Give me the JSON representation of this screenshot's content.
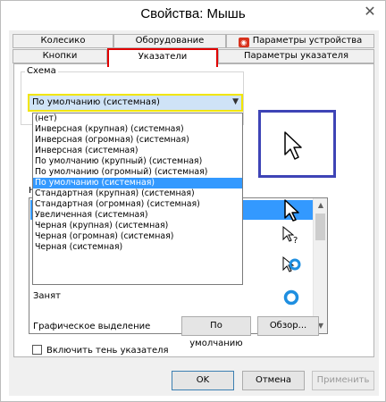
{
  "window": {
    "title": "Свойства: Мышь",
    "close_glyph": "✕"
  },
  "tabs_row1": [
    {
      "label": "Колесико"
    },
    {
      "label": "Оборудование"
    },
    {
      "label": "Параметры устройства",
      "icon": "device-settings-icon"
    }
  ],
  "tabs_row2": [
    {
      "label": "Кнопки"
    },
    {
      "label": "Указатели",
      "active": true
    },
    {
      "label": "Параметры указателя"
    }
  ],
  "scheme": {
    "legend": "Схема",
    "selected": "По умолчанию (системная)",
    "options": [
      "(нет)",
      "Инверсная (крупная) (системная)",
      "Инверсная (огромная) (системная)",
      "Инверсная (системная)",
      "По умолчанию (крупный) (системная)",
      "По умолчанию (огромный) (системная)",
      "По умолчанию (системная)",
      "Стандартная (крупная) (системная)",
      "Стандартная (огромная) (системная)",
      "Увеличенная (системная)",
      "Черная (крупная) (системная)",
      "Черная (огромная) (системная)",
      "Черная (системная)"
    ],
    "selected_index": 6
  },
  "settings_label_prefix": "Н",
  "cursor_list": {
    "rows": [
      {
        "label": "",
        "icon": "arrow-cursor-icon"
      },
      {
        "label": "",
        "icon": "help-cursor-icon"
      },
      {
        "label": "",
        "icon": "working-in-background-icon"
      },
      {
        "label": "Занят",
        "icon": "busy-ring-icon"
      },
      {
        "label": "Графическое выделение",
        "icon": "crosshair-icon"
      }
    ],
    "selected_index": 0
  },
  "shadow_checkbox": {
    "label": "Включить тень указателя",
    "checked": false
  },
  "buttons": {
    "defaults": "По умолчанию",
    "browse": "Обзор...",
    "ok": "OK",
    "cancel": "Отмена",
    "apply": "Применить"
  },
  "colors": {
    "highlight": "#3399ff",
    "tab_annotation": "#e00000",
    "combo_annotation": "#f2e600",
    "preview_annotation": "#3e44b6",
    "busy_ring": "#1f8fe0"
  }
}
